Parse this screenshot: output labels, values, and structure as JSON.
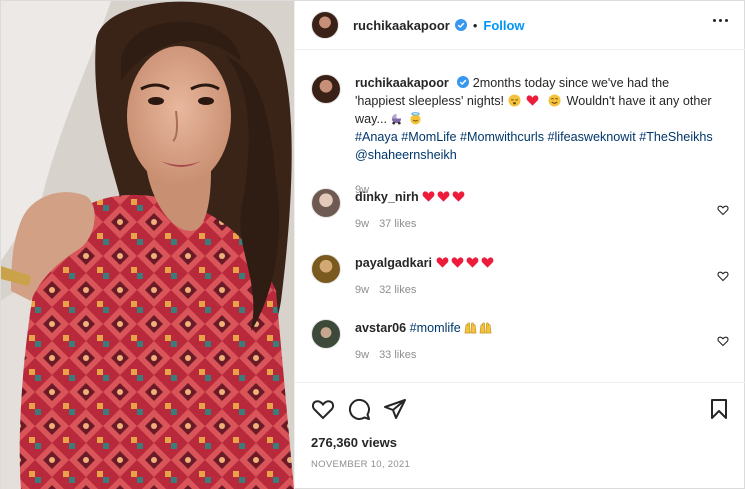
{
  "post": {
    "username": "ruchikaakapoor",
    "follow_label": "Follow",
    "separator": "•"
  },
  "caption": {
    "username": "ruchikaakapoor",
    "text_1": "2months today since we've had the 'happiest sleepless' nights!",
    "text_2": "Wouldn't have it any other way...",
    "hashtags": [
      "#Anaya",
      "#MomLife",
      "#Momwithcurls",
      "#lifeasweknowit",
      "#TheSheikhs"
    ],
    "mention": "@shaheernsheikh",
    "time": "9w"
  },
  "comments": [
    {
      "username": "dinky_nirh",
      "text": "",
      "emojis": [
        "red-heart",
        "red-heart",
        "red-heart"
      ],
      "time": "9w",
      "likes": "37 likes"
    },
    {
      "username": "payalgadkari",
      "text": "",
      "emojis": [
        "red-heart",
        "red-heart",
        "red-heart",
        "red-heart"
      ],
      "time": "9w",
      "likes": "32 likes"
    },
    {
      "username": "avstar06",
      "text": "#momlife",
      "emojis": [
        "raised-hands",
        "raised-hands"
      ],
      "time": "9w",
      "likes": "33 likes"
    }
  ],
  "stats": {
    "views": "276,360 views",
    "date": "NOVEMBER 10, 2021"
  },
  "icons": {
    "verified": "verified-badge-icon",
    "more": "more-options-icon",
    "like": "heart-icon",
    "comment": "comment-icon",
    "share": "paper-plane-icon",
    "save": "bookmark-icon"
  },
  "colors": {
    "link": "#0095f6",
    "hashtag": "#00376b",
    "muted": "#8e8e8e",
    "heart": "#ed1c3b"
  }
}
